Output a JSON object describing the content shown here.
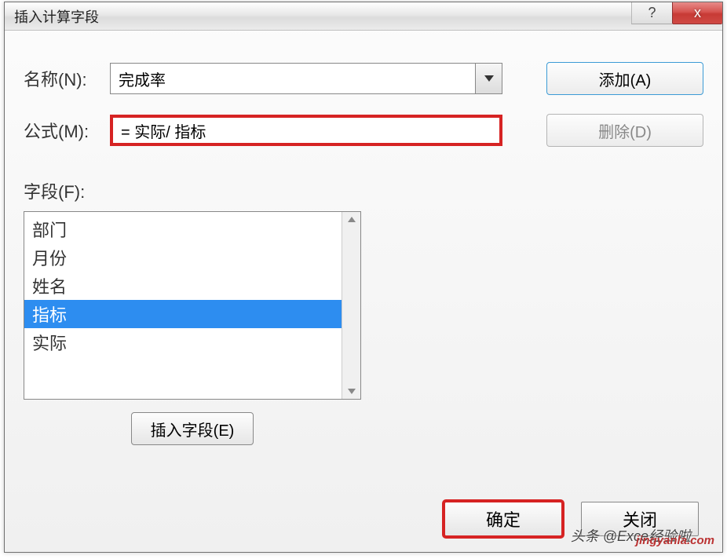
{
  "dialog": {
    "title": "插入计算字段",
    "help_glyph": "?",
    "close_glyph": "x"
  },
  "name_row": {
    "label": "名称(N):",
    "value": "完成率"
  },
  "formula_row": {
    "label": "公式(M):",
    "value": "= 实际/ 指标"
  },
  "buttons": {
    "add": "添加(A)",
    "delete": "删除(D)",
    "insert_field": "插入字段(E)",
    "ok": "确定",
    "close": "关闭"
  },
  "fields": {
    "label": "字段(F):",
    "items": [
      "部门",
      "月份",
      "姓名",
      "指标",
      "实际"
    ],
    "selected_index": 3
  },
  "watermark": {
    "line1": "头条 @Exce经验啦",
    "line2": "jingyanla.com"
  }
}
